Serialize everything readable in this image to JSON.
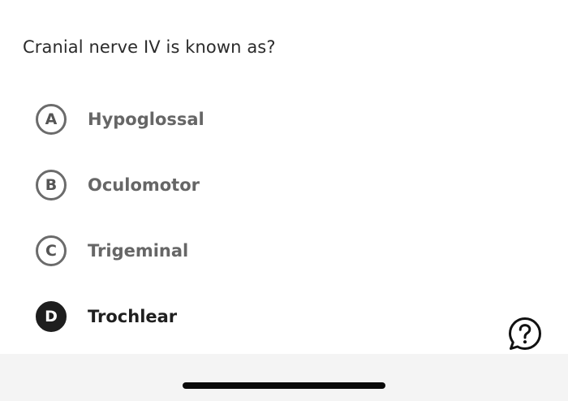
{
  "question": {
    "text": "Cranial nerve IV is known as?"
  },
  "options": [
    {
      "letter": "A",
      "label": "Hypoglossal",
      "selected": false
    },
    {
      "letter": "B",
      "label": "Oculomotor",
      "selected": false
    },
    {
      "letter": "C",
      "label": "Trigeminal",
      "selected": false
    },
    {
      "letter": "D",
      "label": "Trochlear",
      "selected": true
    }
  ],
  "help": {
    "icon": "help-question-bubble-icon"
  },
  "colors": {
    "selected_badge": "#1e1e1e",
    "unselected_outline": "#6b6b6b",
    "bottom_bar": "#f4f4f4"
  }
}
